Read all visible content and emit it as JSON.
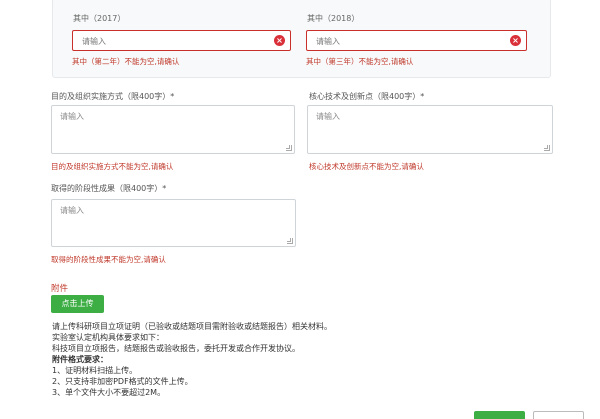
{
  "subpanel": {
    "left_label": "其中（2017）",
    "right_label": "其中（2018）",
    "left_placeholder": "请输入",
    "right_placeholder": "请输入",
    "left_error": "其中（第二年）不能为空,请确认",
    "right_error": "其中（第三年）不能为空,请确认"
  },
  "purpose": {
    "label": "目的及组织实施方式（限400字）*",
    "placeholder": "请输入",
    "error": "目的及组织实施方式不能为空,请确认"
  },
  "core_tech": {
    "label": "核心技术及创新点（限400字）*",
    "placeholder": "请输入",
    "error": "核心技术及创新点不能为空,请确认"
  },
  "results": {
    "label": "取得的阶段性成果（限400字）*",
    "placeholder": "请输入",
    "error": "取得的阶段性成果不能为空,请确认"
  },
  "attachment": {
    "title": "附件",
    "upload_label": "点击上传"
  },
  "instructions": {
    "line1": "请上传科研项目立项证明（已验收或结题项目需附验收或结题报告）相关材料。",
    "line2": "实验室认定机构具体要求如下：",
    "line3": "科技项目立项报告，结题报告或验收报告，委托开发或合作开发协议。",
    "format_title": "附件格式要求：",
    "rule1": "1、证明材料扫描上传。",
    "rule2": "2、只支持非加密PDF格式的文件上传。",
    "rule3": "3、单个文件大小不要超过2M。"
  },
  "colors": {
    "error": "#c0392b",
    "accent_green": "#3cae44"
  }
}
